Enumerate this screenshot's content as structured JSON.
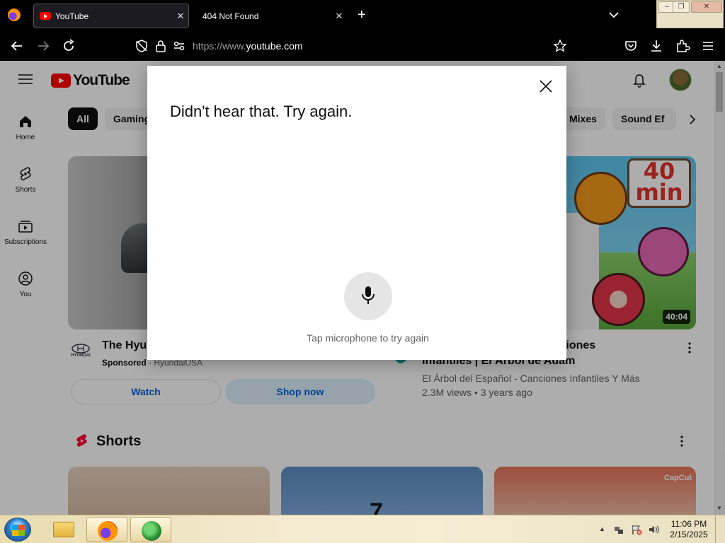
{
  "browser": {
    "tabs": [
      {
        "title": "YouTube",
        "close": "✕"
      },
      {
        "title": "404 Not Found",
        "close": "✕"
      }
    ],
    "new_tab": "+",
    "url": {
      "prefix": "https://www.",
      "host": "youtube.com"
    },
    "window_controls": {
      "minimize": "–",
      "restore": "❐",
      "close": "✕"
    }
  },
  "youtube": {
    "logo_text": "YouTube",
    "sidebar": [
      {
        "label": "Home",
        "icon": "home-icon"
      },
      {
        "label": "Shorts",
        "icon": "shorts-icon"
      },
      {
        "label": "Subscriptions",
        "icon": "subscriptions-icon"
      },
      {
        "label": "You",
        "icon": "you-icon"
      }
    ],
    "chips": [
      "All",
      "Gaming",
      "Mixes",
      "Sound Ef"
    ],
    "ad": {
      "title": "The Hyun",
      "sponsored": "Sponsored",
      "advertiser": "HyundaiUSA",
      "logo_text": "HYUNDAI",
      "watch_label": "Watch",
      "shop_label": "Shop now"
    },
    "video": {
      "title_line1": "ás Canciones",
      "title_line2": "Infantiles | El Árbol de Adam",
      "channel": "El Árbol del Español - Canciones Infantiles Y Más",
      "views": "2.3M views",
      "age": "3 years ago",
      "duration": "40:04",
      "thumb_sign_num": "40",
      "thumb_sign_unit": "min"
    },
    "shorts": {
      "title": "Shorts",
      "capcut": "CapCut",
      "short2_glyph": "7"
    }
  },
  "voice_modal": {
    "message": "Didn't hear that. Try again.",
    "hint": "Tap microphone to try again"
  },
  "taskbar": {
    "time": "11:06 PM",
    "date": "2/15/2025",
    "tray_arrow": "▲"
  }
}
